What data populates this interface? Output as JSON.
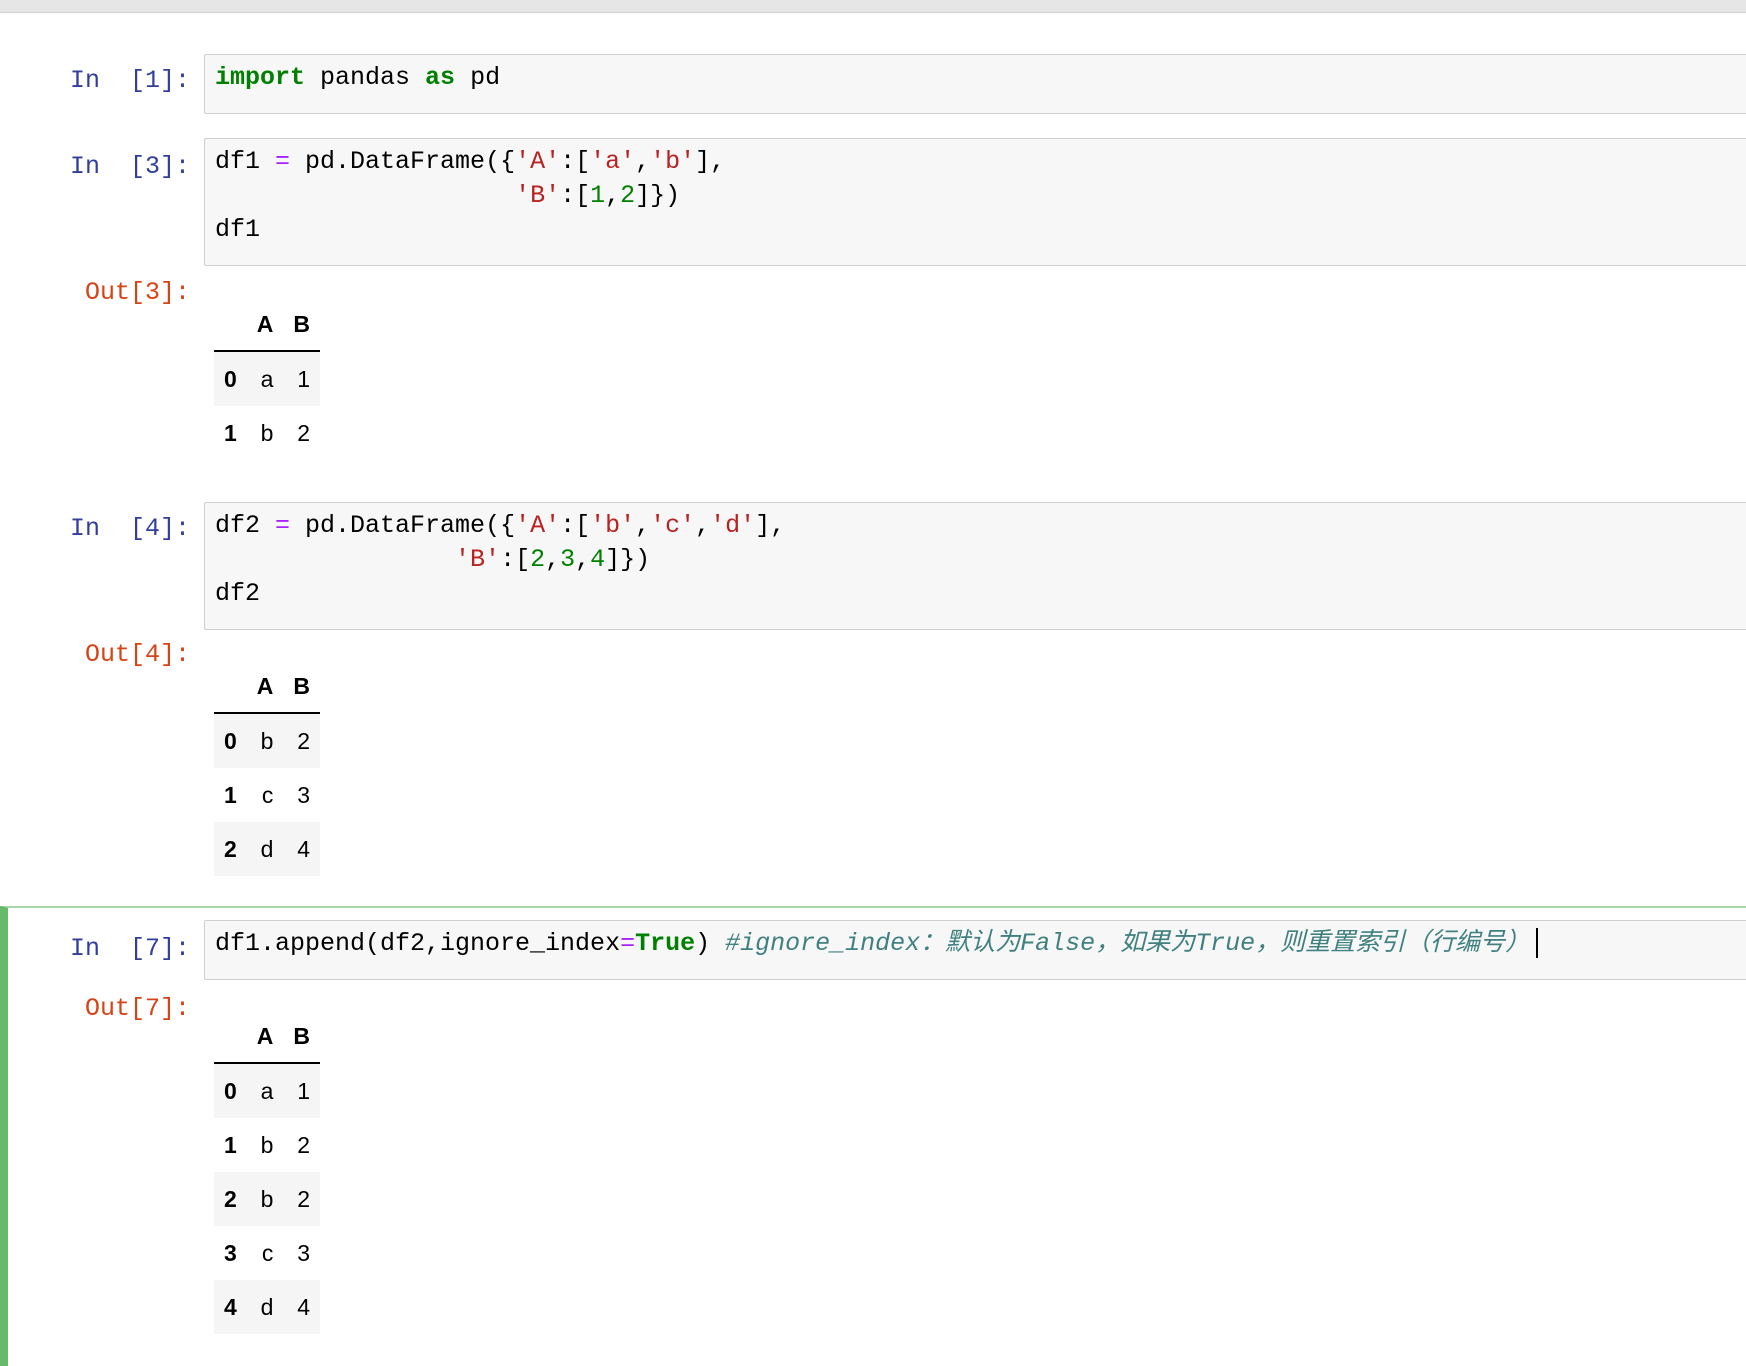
{
  "cells": [
    {
      "in_prompt": "In  [1]:",
      "code": [
        [
          {
            "t": "import",
            "c": "kw"
          },
          {
            "t": " pandas ",
            "c": ""
          },
          {
            "t": "as",
            "c": "kw"
          },
          {
            "t": " pd",
            "c": ""
          }
        ]
      ]
    },
    {
      "in_prompt": "In  [3]:",
      "code": [
        [
          {
            "t": "df1 ",
            "c": ""
          },
          {
            "t": "=",
            "c": "op"
          },
          {
            "t": " pd.DataFrame({",
            "c": ""
          },
          {
            "t": "'A'",
            "c": "str"
          },
          {
            "t": ":[",
            "c": ""
          },
          {
            "t": "'a'",
            "c": "str"
          },
          {
            "t": ",",
            "c": ""
          },
          {
            "t": "'b'",
            "c": "str"
          },
          {
            "t": "],",
            "c": ""
          }
        ],
        [
          {
            "t": "                    ",
            "c": ""
          },
          {
            "t": "'B'",
            "c": "str"
          },
          {
            "t": ":[",
            "c": ""
          },
          {
            "t": "1",
            "c": "num"
          },
          {
            "t": ",",
            "c": ""
          },
          {
            "t": "2",
            "c": "num"
          },
          {
            "t": "]})",
            "c": ""
          }
        ],
        [
          {
            "t": "df1",
            "c": ""
          }
        ]
      ],
      "out_prompt": "Out[3]:",
      "table": {
        "columns": [
          "",
          "A",
          "B"
        ],
        "rows": [
          [
            "0",
            "a",
            "1"
          ],
          [
            "1",
            "b",
            "2"
          ]
        ]
      }
    },
    {
      "in_prompt": "In  [4]:",
      "code": [
        [
          {
            "t": "df2 ",
            "c": ""
          },
          {
            "t": "=",
            "c": "op"
          },
          {
            "t": " pd.DataFrame({",
            "c": ""
          },
          {
            "t": "'A'",
            "c": "str"
          },
          {
            "t": ":[",
            "c": ""
          },
          {
            "t": "'b'",
            "c": "str"
          },
          {
            "t": ",",
            "c": ""
          },
          {
            "t": "'c'",
            "c": "str"
          },
          {
            "t": ",",
            "c": ""
          },
          {
            "t": "'d'",
            "c": "str"
          },
          {
            "t": "],",
            "c": ""
          }
        ],
        [
          {
            "t": "                ",
            "c": ""
          },
          {
            "t": "'B'",
            "c": "str"
          },
          {
            "t": ":[",
            "c": ""
          },
          {
            "t": "2",
            "c": "num"
          },
          {
            "t": ",",
            "c": ""
          },
          {
            "t": "3",
            "c": "num"
          },
          {
            "t": ",",
            "c": ""
          },
          {
            "t": "4",
            "c": "num"
          },
          {
            "t": "]})",
            "c": ""
          }
        ],
        [
          {
            "t": "df2",
            "c": ""
          }
        ]
      ],
      "out_prompt": "Out[4]:",
      "table": {
        "columns": [
          "",
          "A",
          "B"
        ],
        "rows": [
          [
            "0",
            "b",
            "2"
          ],
          [
            "1",
            "c",
            "3"
          ],
          [
            "2",
            "d",
            "4"
          ]
        ]
      }
    },
    {
      "in_prompt": "In  [7]:",
      "code": [
        [
          {
            "t": "df1.append(df2,ignore_index",
            "c": ""
          },
          {
            "t": "=",
            "c": "op"
          },
          {
            "t": "True",
            "c": "kw"
          },
          {
            "t": ") ",
            "c": ""
          },
          {
            "t": "#ignore_index：默认为False，如果为True，则重置索引（行编号）",
            "c": "cmt"
          }
        ]
      ],
      "out_prompt": "Out[7]:",
      "table": {
        "columns": [
          "",
          "A",
          "B"
        ],
        "rows": [
          [
            "0",
            "a",
            "1"
          ],
          [
            "1",
            "b",
            "2"
          ],
          [
            "2",
            "b",
            "2"
          ],
          [
            "3",
            "c",
            "3"
          ],
          [
            "4",
            "d",
            "4"
          ]
        ]
      }
    }
  ]
}
